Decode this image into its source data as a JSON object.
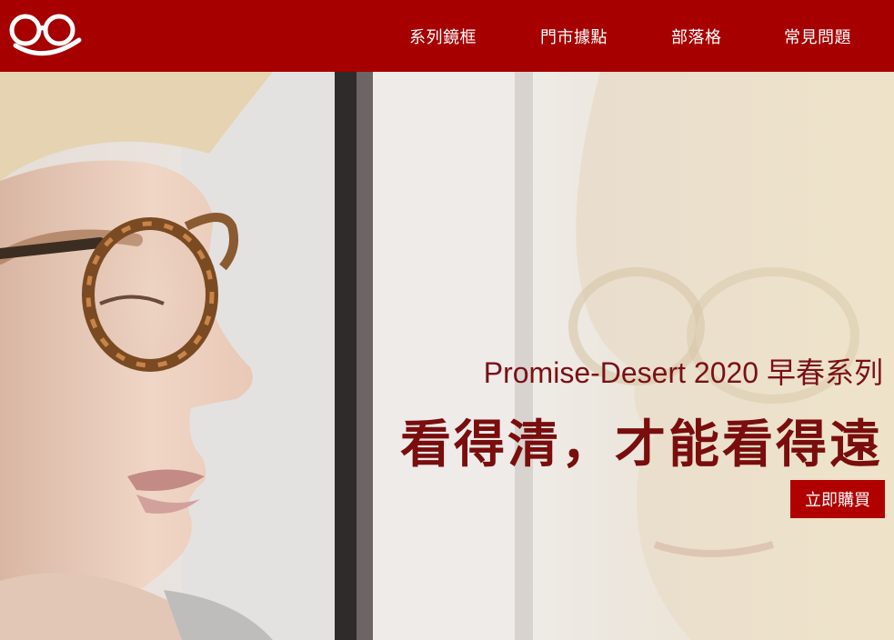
{
  "brand": {
    "logo_icon": "glasses-smile-logo",
    "header_color": "#a60000"
  },
  "nav": {
    "items": [
      {
        "label": "系列鏡框"
      },
      {
        "label": "門市據點"
      },
      {
        "label": "部落格"
      },
      {
        "label": "常見問題"
      }
    ]
  },
  "hero": {
    "subtitle": "Promise-Desert 2020 早春系列",
    "title": "看得清，才能看得遠",
    "cta_label": "立即購買",
    "accent_color": "#7a0d0d",
    "button_color": "#b00000"
  }
}
